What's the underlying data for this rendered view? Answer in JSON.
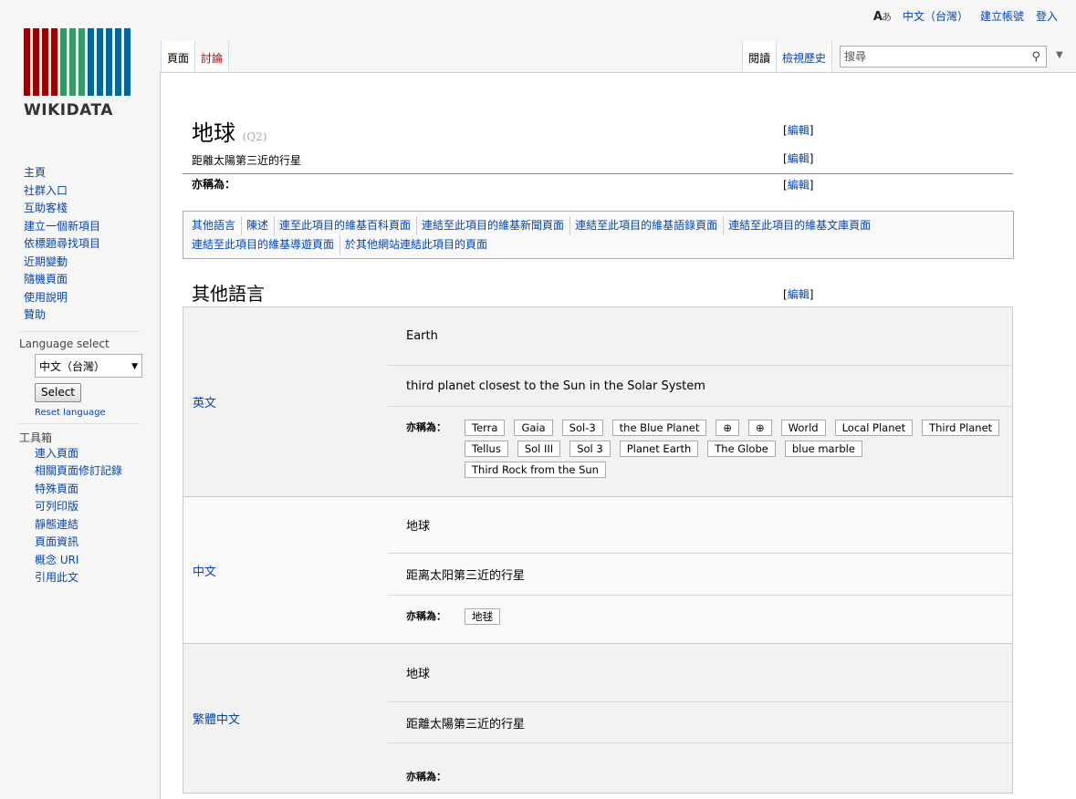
{
  "personal": {
    "lang_label": "中文（台灣）",
    "create_account": "建立帳號",
    "login": "登入"
  },
  "logo": {
    "text": "WIKIDATA",
    "bar_colors": [
      "#990000",
      "#990000",
      "#990000",
      "#990000",
      "#339966",
      "#339966",
      "#339966",
      "#006699",
      "#006699",
      "#006699",
      "#006699",
      "#006699"
    ]
  },
  "nav": [
    "主頁",
    "社群入口",
    "互助客棧",
    "建立一個新項目",
    "依標題尋找項目",
    "近期變動",
    "隨機頁面",
    "使用說明",
    "贊助"
  ],
  "language_select": {
    "heading": "Language select",
    "current": "中文（台灣）",
    "button": "Select",
    "reset": "Reset language"
  },
  "toolbox": {
    "heading": "工具箱",
    "items": [
      "連入頁面",
      "相關頁面修訂記錄",
      "特殊頁面",
      "可列印版",
      "靜態連結",
      "頁面資訊",
      "概念 URI",
      "引用此文"
    ]
  },
  "tabs": {
    "page": "頁面",
    "talk": "討論",
    "read": "閱讀",
    "history": "檢視歷史"
  },
  "search": {
    "placeholder": "搜尋"
  },
  "item": {
    "label": "地球",
    "qid": "(Q2)",
    "description": "距離太陽第三近的行星",
    "aka": "亦稱為：",
    "edit": "編輯"
  },
  "toc": [
    "其他語言",
    "陳述",
    "連至此項目的維基百科頁面",
    "連結至此項目的維基新聞頁面",
    "連結至此項目的維基語錄頁面",
    "連結至此項目的維基文庫頁面",
    "連結至此項目的維基導遊頁面",
    "於其他網站連結此項目的頁面"
  ],
  "other_languages": {
    "heading": "其他語言",
    "aka": "亦稱為：",
    "rows": [
      {
        "name": "英文",
        "label": "Earth",
        "description": "third planet closest to the Sun in the Solar System",
        "aliases": [
          "Terra",
          "Gaia",
          "Sol-3",
          "the Blue Planet",
          "⊕",
          "⊕",
          "World",
          "Local Planet",
          "Third Planet",
          "Tellus",
          "Sol III",
          "Sol 3",
          "Planet Earth",
          "The Globe",
          "blue marble",
          "Third Rock from the Sun"
        ]
      },
      {
        "name": "中文",
        "label": "地球",
        "description": "距离太阳第三近的行星",
        "aliases": [
          "地毬"
        ]
      },
      {
        "name": "繁體中文",
        "label": "地球",
        "description": "距離太陽第三近的行星",
        "aliases": []
      }
    ]
  }
}
